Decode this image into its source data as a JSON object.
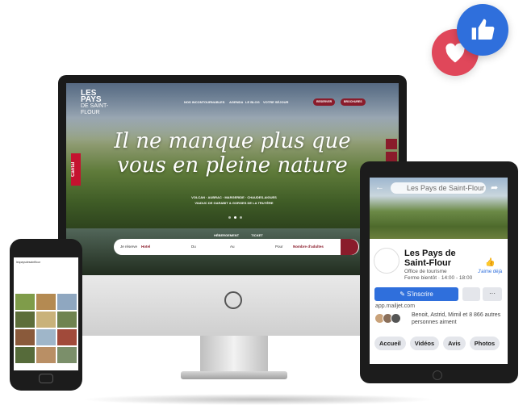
{
  "colors": {
    "brand": "#8a1c2b",
    "facebook_blue": "#2f6fdc",
    "heart_red": "#e0475a"
  },
  "reactions": {
    "like_icon": "thumbs-up-icon",
    "heart_icon": "heart-icon"
  },
  "website": {
    "logo": {
      "line1": "LES",
      "line2": "PAYS",
      "line3": "DE SAINT-FLOUR"
    },
    "nav": [
      "NOS INCONTOURNABLES",
      "AGENDA",
      "LE BLOG",
      "VOTRE SÉJOUR"
    ],
    "nav_buttons": [
      "RESERVER",
      "BROCHURES"
    ],
    "hero_line1": "Il ne manque plus que",
    "hero_line2": "vous en pleine nature",
    "tags_line1": "VOLCAN · AUBRAC · MARGERIDE · CHAUDES-AIGUES",
    "tags_line2": "VIADUC DE GARABIT & GORGES DE LA TRUYÈRE",
    "cantal_badge": "Cantal",
    "tabs": [
      "HÉBERGEMENT",
      "TICKET"
    ],
    "booking": {
      "label": "Je réserve",
      "type": "Hotel",
      "du": "Du",
      "au": "Au",
      "pour": "Pour",
      "guests": "Nombre d'adultes",
      "go": "OK"
    }
  },
  "phone": {
    "header": "lespaysdesaintflour"
  },
  "facebook": {
    "search": "Les Pays de Saint-Flour",
    "page_name": "Les Pays de Saint-Flour",
    "page_type": "Office de tourisme",
    "hours": "Ferme bientôt · 14:00 - 18:00",
    "like_label": "J'aime déjà",
    "subscribe": "S'inscrire",
    "more": "···",
    "url": "app.mailjet.com",
    "likes_text": "Benoit, Astrid, Mimil et 8 866 autres personnes aiment",
    "chips": [
      "Accueil",
      "Vidéos",
      "Avis",
      "Photos"
    ]
  }
}
